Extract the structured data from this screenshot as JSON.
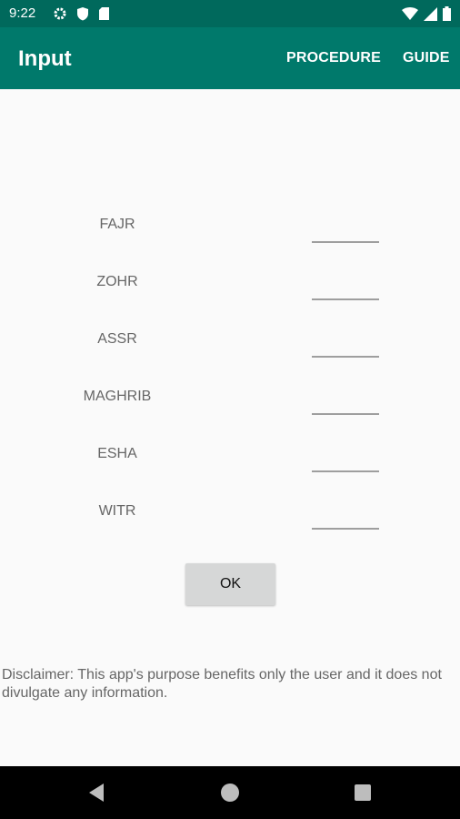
{
  "status_bar": {
    "time": "9:22",
    "icons": [
      "gear-icon",
      "shield-icon",
      "sd-card-icon",
      "wifi-icon",
      "signal-icon",
      "battery-icon"
    ]
  },
  "app_bar": {
    "title": "Input",
    "actions": [
      "PROCEDURE",
      "GUIDE"
    ],
    "color": "#00796b"
  },
  "rows": [
    {
      "label": "FAJR",
      "value": ""
    },
    {
      "label": "ZOHR",
      "value": ""
    },
    {
      "label": "ASSR",
      "value": ""
    },
    {
      "label": "MAGHRIB",
      "value": ""
    },
    {
      "label": "ESHA",
      "value": ""
    },
    {
      "label": "WITR",
      "value": ""
    }
  ],
  "ok_label": "OK",
  "disclaimer": "Disclaimer: This app's purpose benefits only the user and it does not divulgate any information.",
  "nav_bar": {
    "icons": [
      "back-icon",
      "home-icon",
      "recents-icon"
    ]
  }
}
